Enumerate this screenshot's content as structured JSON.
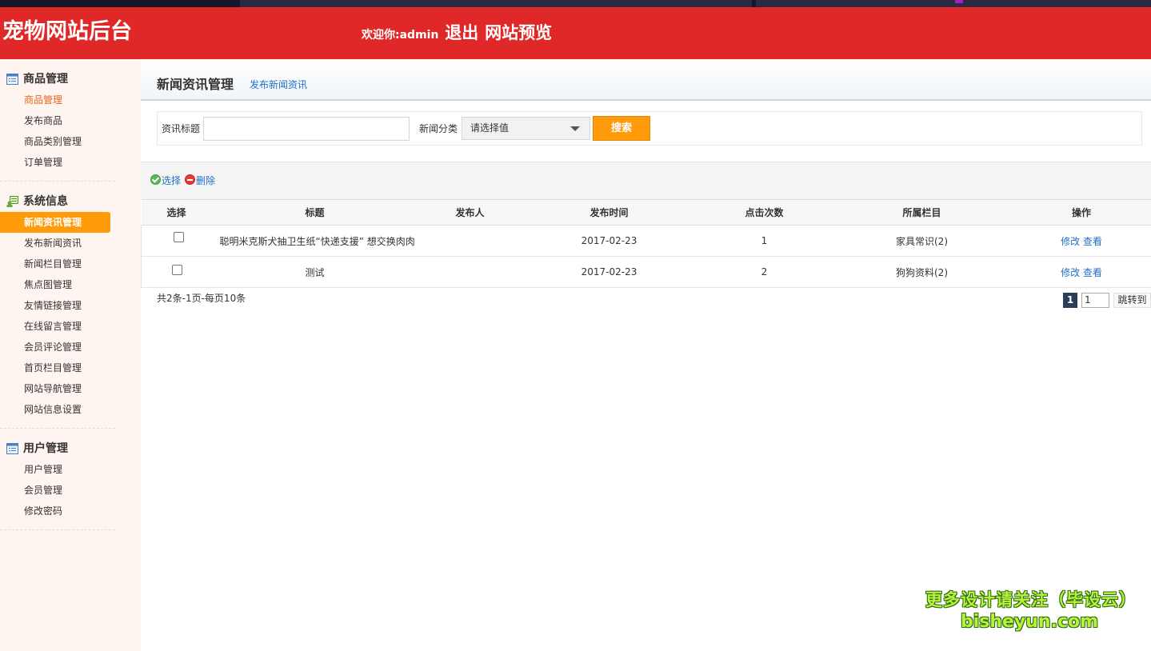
{
  "header": {
    "title": "宠物网站后台",
    "welcome": "欢迎你:admin",
    "logout": "退出",
    "preview": "网站预览"
  },
  "sidebar": {
    "groups": [
      {
        "title": "商品管理",
        "icon": "list-icon",
        "items": [
          "商品管理",
          "发布商品",
          "商品类别管理",
          "订单管理"
        ]
      },
      {
        "title": "系统信息",
        "icon": "system-info-icon",
        "items": [
          "新闻资讯管理",
          "发布新闻资讯",
          "新闻栏目管理",
          "焦点图管理",
          "友情链接管理",
          "在线留言管理",
          "会员评论管理",
          "首页栏目管理",
          "网站导航管理",
          "网站信息设置"
        ]
      },
      {
        "title": "用户管理",
        "icon": "list-icon",
        "items": [
          "用户管理",
          "会员管理",
          "修改密码"
        ]
      }
    ]
  },
  "page": {
    "title": "新闻资讯管理",
    "link": "发布新闻资讯"
  },
  "search": {
    "title_label": "资讯标题",
    "title_value": "",
    "category_label": "新闻分类",
    "category_selected": "请选择值",
    "button": "搜索"
  },
  "toolbar": {
    "select": "选择",
    "delete": "删除"
  },
  "table": {
    "columns": [
      "选择",
      "标题",
      "发布人",
      "发布时间",
      "点击次数",
      "所属栏目",
      "操作"
    ],
    "rows": [
      {
        "title": "聪明米克斯犬抽卫生纸“快递支援” 想交换肉肉",
        "publisher": "",
        "date": "2017-02-23",
        "clicks": "1",
        "category": "家具常识(2)",
        "edit": "修改",
        "view": "查看"
      },
      {
        "title": "测试",
        "publisher": "",
        "date": "2017-02-23",
        "clicks": "2",
        "category": "狗狗资料(2)",
        "edit": "修改",
        "view": "查看"
      }
    ]
  },
  "pagination": {
    "summary": "共2条-1页-每页10条",
    "current_page": "1",
    "jump_value": "1",
    "jump_label": "跳转到"
  },
  "watermark": {
    "line1": "更多设计请关注（毕设云）",
    "line2": "bisheyun.com"
  },
  "colors": {
    "header_red": "#e02828",
    "active_orange": "#ff9a0a",
    "link_blue": "#1f6fc5"
  }
}
